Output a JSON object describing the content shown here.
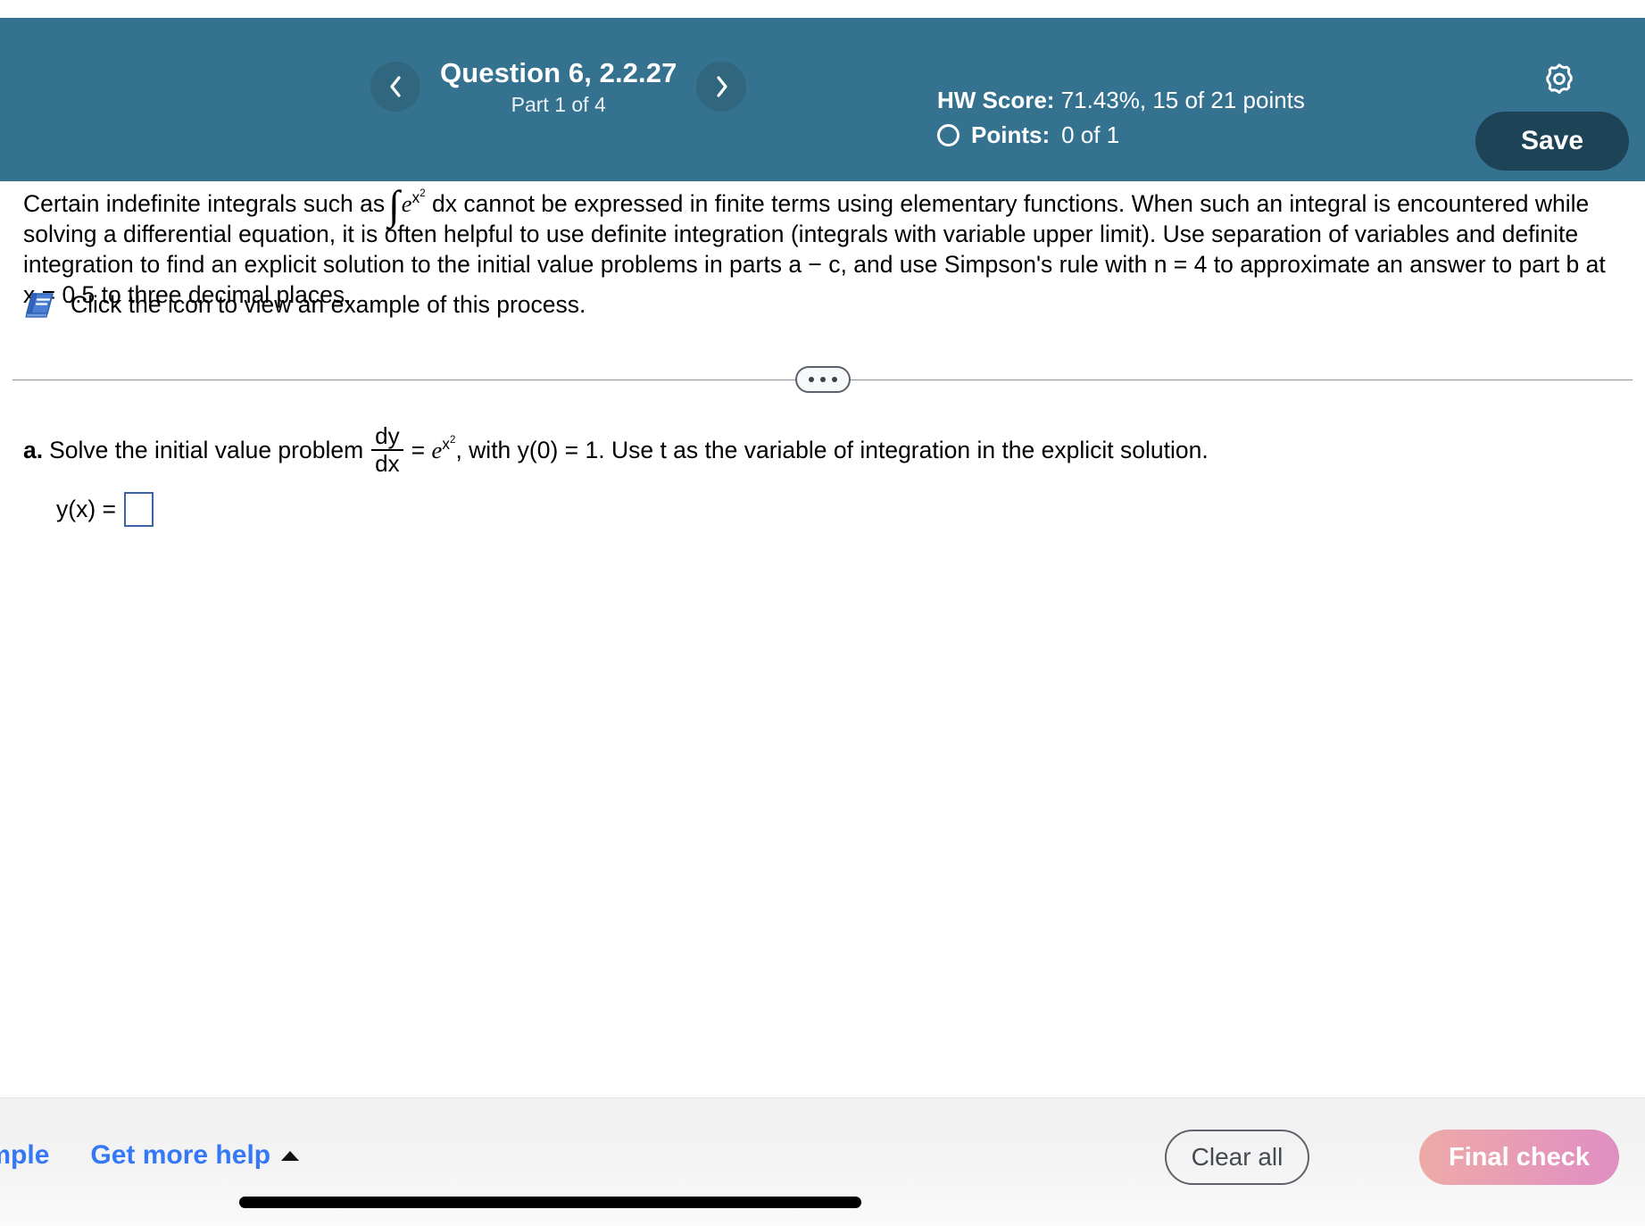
{
  "header": {
    "prev_label": "‹",
    "next_label": "›",
    "question_title": "Question 6, 2.2.27",
    "part_label": "Part 1 of 4",
    "hw_score_label": "HW Score:",
    "hw_score_value": "71.43%, 15 of 21 points",
    "points_label": "Points:",
    "points_value": "0 of 1",
    "settings_icon": "gear-icon",
    "save_label": "Save",
    "background_color": "#357290",
    "save_background_color": "#1d4356"
  },
  "problem": {
    "text_1": "Certain indefinite integrals such as",
    "integral_symbol": "∫",
    "integrand_base": "e",
    "integrand_exponent": "x",
    "integrand_exponent_power": "2",
    "text_2": "dx cannot be expressed in finite terms using elementary functions. When such an integral is encountered while solving a differential equation, it is often helpful to use definite integration (integrals with variable upper limit). Use separation of variables and definite integration to find an explicit solution to the initial value problems in parts a − c, and use Simpson's rule with n = 4 to approximate an answer to part b at x = 0.5 to three decimal places.",
    "icon_line": "Click the icon to view an example of this process.",
    "book_icon": "book-icon"
  },
  "divider": {
    "ellipsis": "•••"
  },
  "part_a": {
    "label": "a.",
    "text_1": "Solve the initial value problem",
    "frac_numerator": "dy",
    "frac_denominator": "dx",
    "equals": "=",
    "rhs_base": "e",
    "rhs_exponent": "x",
    "rhs_exponent_power": "2",
    "text_2": ", with y(0) = 1. Use t as the variable of integration in the explicit solution.",
    "answer_label": "y(x) =",
    "answer_value": "",
    "answer_border_color": "#3c63a8"
  },
  "bottom_bar": {
    "example_label": "xample",
    "get_more_help_label": "Get more help",
    "caret": "caret-up-icon",
    "clear_all_label": "Clear all",
    "final_check_label": "Final check",
    "link_color": "#3478f6",
    "final_check_gradient_from": "#eeaaa8",
    "final_check_gradient_to": "#e08ec3"
  }
}
